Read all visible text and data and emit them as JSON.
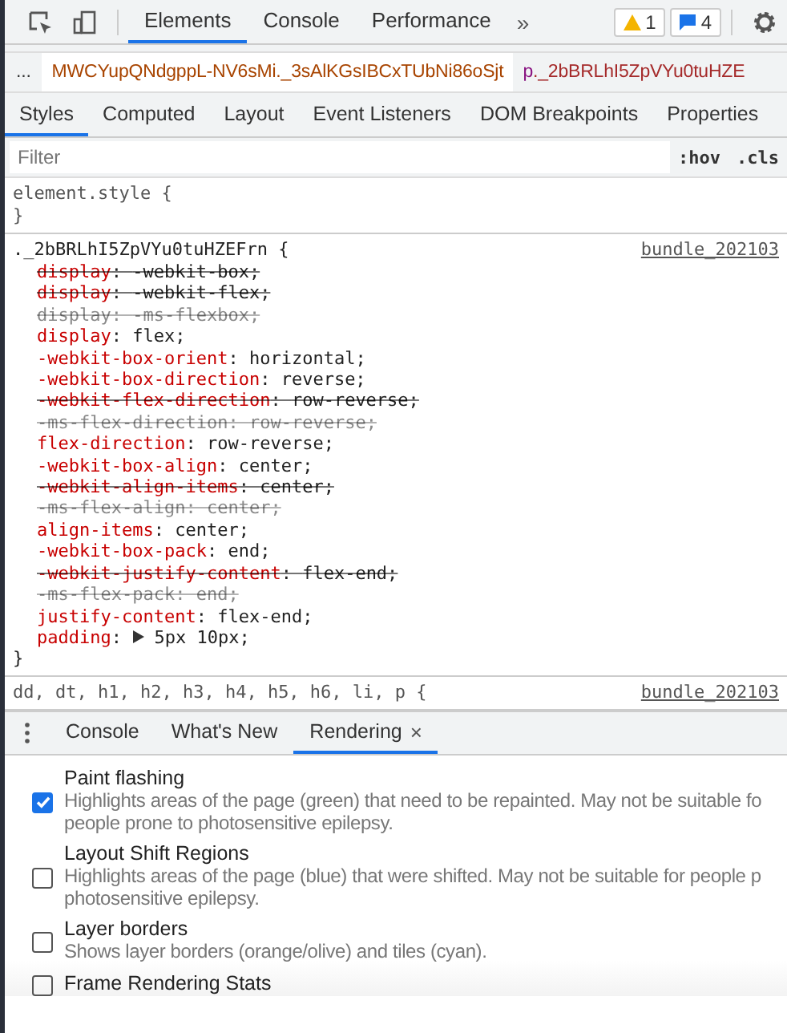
{
  "toolbar": {
    "tabs": [
      {
        "label": "Elements",
        "selected": true
      },
      {
        "label": "Console",
        "selected": false
      },
      {
        "label": "Performance",
        "selected": false
      }
    ],
    "more": "»",
    "warnings": "1",
    "messages": "4"
  },
  "breadcrumb": {
    "ellipsis": "...",
    "items": [
      {
        "label": "MWCYupQNdgppL-NV6sMi._3sAlKGsIBCxTUbNi86oSjt",
        "selected": true
      },
      {
        "label": "p._2bBRLhI5ZpVYu0tuHZE",
        "selected": false
      }
    ]
  },
  "subtabs": [
    {
      "label": "Styles",
      "selected": true
    },
    {
      "label": "Computed",
      "selected": false
    },
    {
      "label": "Layout",
      "selected": false
    },
    {
      "label": "Event Listeners",
      "selected": false
    },
    {
      "label": "DOM Breakpoints",
      "selected": false
    },
    {
      "label": "Properties",
      "selected": false
    }
  ],
  "filter": {
    "placeholder": "Filter",
    "hov": ":hov",
    "cls": ".cls"
  },
  "element_style": {
    "open": "element.style {",
    "close": "}"
  },
  "rule": {
    "selector": "._2bBRLhI5ZpVYu0tuHZEFrn {",
    "source": "bundle_202103",
    "close": "}",
    "separator": ":",
    "declarations": [
      {
        "prop": "display",
        "value": "-webkit-box;",
        "overridden": true,
        "invalid": false
      },
      {
        "prop": "display",
        "value": "-webkit-flex;",
        "overridden": true,
        "invalid": false
      },
      {
        "prop": "display",
        "value": "-ms-flexbox;",
        "overridden": true,
        "invalid": true
      },
      {
        "prop": "display",
        "value": "flex;",
        "overridden": false,
        "invalid": false
      },
      {
        "prop": "-webkit-box-orient",
        "value": "horizontal;",
        "overridden": false,
        "invalid": false
      },
      {
        "prop": "-webkit-box-direction",
        "value": "reverse;",
        "overridden": false,
        "invalid": false
      },
      {
        "prop": "-webkit-flex-direction",
        "value": "row-reverse;",
        "overridden": true,
        "invalid": false
      },
      {
        "prop": "-ms-flex-direction",
        "value": "row-reverse;",
        "overridden": true,
        "invalid": true
      },
      {
        "prop": "flex-direction",
        "value": "row-reverse;",
        "overridden": false,
        "invalid": false
      },
      {
        "prop": "-webkit-box-align",
        "value": "center;",
        "overridden": false,
        "invalid": false
      },
      {
        "prop": "-webkit-align-items",
        "value": "center;",
        "overridden": true,
        "invalid": false
      },
      {
        "prop": "-ms-flex-align",
        "value": "center;",
        "overridden": true,
        "invalid": true
      },
      {
        "prop": "align-items",
        "value": "center;",
        "overridden": false,
        "invalid": false
      },
      {
        "prop": "-webkit-box-pack",
        "value": "end;",
        "overridden": false,
        "invalid": false
      },
      {
        "prop": "-webkit-justify-content",
        "value": "flex-end;",
        "overridden": true,
        "invalid": false
      },
      {
        "prop": "-ms-flex-pack",
        "value": "end;",
        "overridden": true,
        "invalid": true
      },
      {
        "prop": "justify-content",
        "value": "flex-end;",
        "overridden": false,
        "invalid": false
      },
      {
        "prop": "padding",
        "value": "5px 10px;",
        "overridden": false,
        "invalid": false,
        "expandable": true
      }
    ]
  },
  "next_rule": {
    "selector": "dd, dt, h1, h2, h3, h4, h5, h6, li, p {",
    "source": "bundle_202103"
  },
  "drawer": {
    "tabs": [
      {
        "label": "Console",
        "selected": false,
        "closable": false
      },
      {
        "label": "What's New",
        "selected": false,
        "closable": false
      },
      {
        "label": "Rendering",
        "selected": true,
        "closable": true
      }
    ],
    "close": "×"
  },
  "rendering": [
    {
      "title": "Paint flashing",
      "checked": true,
      "description": "Highlights areas of the page (green) that need to be repainted. May not be suitable fo\npeople prone to photosensitive epilepsy."
    },
    {
      "title": "Layout Shift Regions",
      "checked": false,
      "description": "Highlights areas of the page (blue) that were shifted. May not be suitable for people p\nphotosensitive epilepsy."
    },
    {
      "title": "Layer borders",
      "checked": false,
      "description": "Shows layer borders (orange/olive) and tiles (cyan)."
    },
    {
      "title": "Frame Rendering Stats",
      "checked": false
    }
  ]
}
